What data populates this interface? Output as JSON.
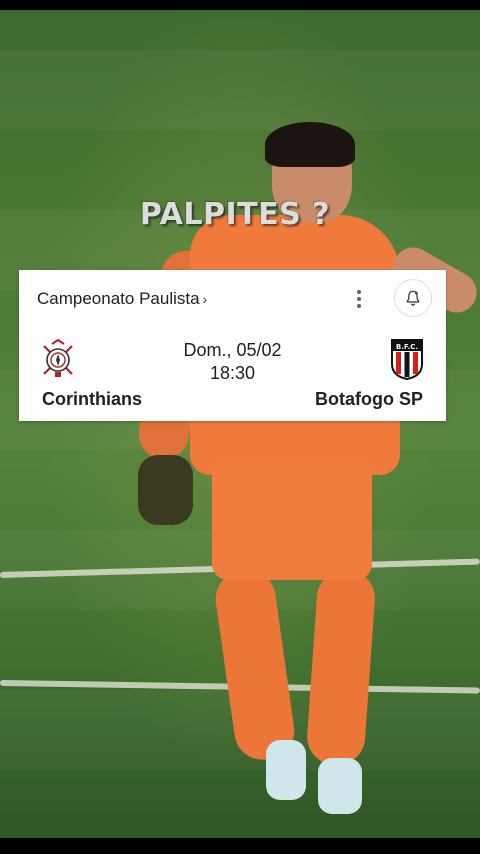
{
  "video": {
    "headline": "PALPITES ?"
  },
  "match_card": {
    "competition": "Campeonato Paulista",
    "chevron": "›",
    "date": "Dom., 05/02",
    "time": "18:30",
    "home_team": "Corinthians",
    "away_team": "Botafogo SP",
    "home_crest_icon": "corinthians-crest-icon",
    "away_crest_icon": "botafogo-sp-crest-icon",
    "away_crest_text": "B.F.C.",
    "colors": {
      "card_bg": "#ffffff",
      "text": "#202124",
      "secondary": "#5f6368"
    }
  }
}
